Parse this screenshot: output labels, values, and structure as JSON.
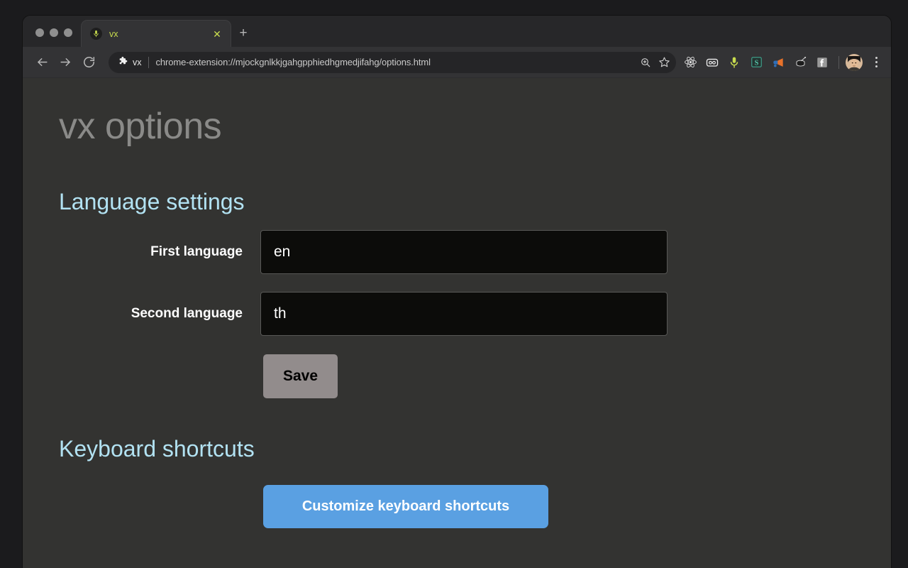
{
  "window": {
    "traffic_lights": [
      "close",
      "minimize",
      "maximize"
    ]
  },
  "tab_strip": {
    "active_tab": {
      "title": "vx",
      "favicon": "microphone-icon",
      "close_label": "✕"
    },
    "new_tab_label": "+"
  },
  "toolbar": {
    "back_icon": "back-arrow-icon",
    "forward_icon": "forward-arrow-icon",
    "reload_icon": "reload-icon",
    "extension_chip": {
      "icon": "puzzle-piece-icon",
      "label": "vx"
    },
    "url": "chrome-extension://mjockgnlkkjgahgpphiedhgmedjifahg/options.html",
    "zoom_icon": "zoom-magnifier-icon",
    "bookmark_icon": "star-icon",
    "extension_icons": [
      "react-atom-icon",
      "loom-goggles-icon",
      "microphone-icon",
      "scribe-s-icon",
      "megaphone-icon",
      "drum-icon",
      "facebook-icon"
    ],
    "avatar": "profile-avatar",
    "menu_icon": "three-dot-menu-icon"
  },
  "page": {
    "title": "vx options",
    "sections": [
      {
        "heading": "Language settings",
        "fields": [
          {
            "label": "First language",
            "value": "en",
            "placeholder": ""
          },
          {
            "label": "Second language",
            "value": "th",
            "placeholder": ""
          }
        ],
        "save_label": "Save"
      },
      {
        "heading": "Keyboard shortcuts",
        "button_label": "Customize keyboard shortcuts"
      }
    ]
  },
  "colors": {
    "desktop": "#1b1b1d",
    "page_background": "#333331",
    "heading_blue": "#b2e2f2",
    "title_gray": "#8a8a88",
    "input_background": "#0c0c0a",
    "save_button": "#928c8c",
    "primary_button": "#5aa0e2",
    "tab_accent": "#c8dc4e"
  }
}
